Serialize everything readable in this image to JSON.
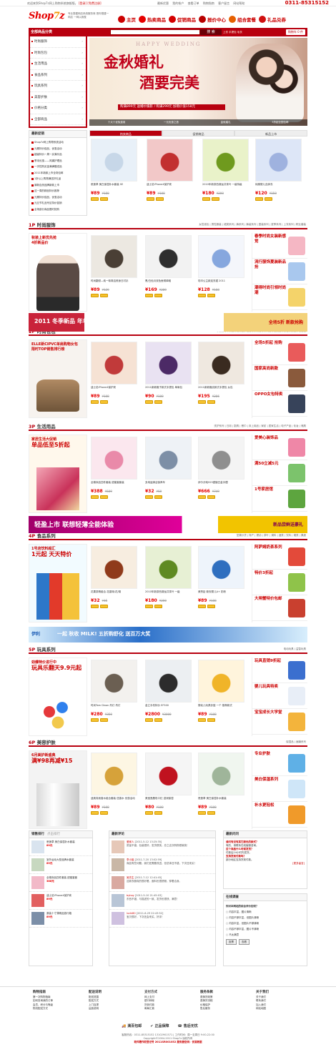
{
  "topbar": {
    "welcome": "欢迎来到Shop7z网上购物系统旗舰版。",
    "login": "[登录]",
    "register": "[免费注册]",
    "links": [
      "最新优惠",
      "我的帐户",
      "查看订单",
      "购物指南",
      "客户留言",
      "网站帮助"
    ],
    "phone": "0311-85315152"
  },
  "header": {
    "logo_a": "Shop",
    "logo_b": "7",
    "logo_c": "z",
    "slogan": "专业搭建网店系统服务商 把你搭建一网店 一网以我做",
    "nav": [
      {
        "label": "主页",
        "color": "#c00"
      },
      {
        "label": "热卖商品",
        "color": "#e60000"
      },
      {
        "label": "促销商品",
        "color": "#d40000"
      },
      {
        "label": "报价中心",
        "color": "#b80000"
      },
      {
        "label": "组合套餐",
        "color": "#e66000"
      },
      {
        "label": "礼品兑券",
        "color": "#d01010"
      }
    ]
  },
  "searchbar": {
    "category_title": "全部商品分类",
    "placeholder": "",
    "search_label": "搜 索",
    "hotwords": "上衣  手提包  毛衣",
    "cart": "购物车 0 件"
  },
  "categories": [
    "时尚服饰",
    "时尚包包",
    "生活用品",
    "食品系列",
    "玩具系列",
    "美容护肤",
    "价格分类",
    "全部商品"
  ],
  "banner": {
    "happy": "HAPPY WEDDING",
    "title1": "金秋婚礼",
    "title2": "酒要完美",
    "promo": "购满899元 送婚纱摄影 / 购满299元 加赠价值158元",
    "tabs": [
      "十大十优免费用",
      "一元优惠之旅",
      "金秋婚礼",
      "3折起全国包邮"
    ]
  },
  "news": {
    "title": "最新促销",
    "items": [
      "Shop7z网上购物系统活动",
      "元素特价促品，优惠活动",
      "超级特价一周一买满乐品",
      "季末优惠——风痛护理品",
      "一次性购买金满满赠送品",
      "2011年新款上市全场包邮",
      "1折以上购物满送好礼品",
      "清新自然品牌新款上市",
      "这一周的精品特价推荐",
      "元素特价促品，优惠活动",
      "元旦节礼品专区特价促销",
      "全场部分商品限时抢购"
    ]
  },
  "promo_tabs": [
    "热卖商品",
    "促销商品",
    "新品上市"
  ],
  "row0": [
    {
      "name": "悉莲草 美白保湿补水套装 SE",
      "price": "¥89",
      "old": "¥180",
      "colors": [
        "#e8f0f8",
        "#c7d7e8"
      ]
    },
    {
      "name": "迪士尼iPhone4保护壳",
      "price": "¥89",
      "old": "¥108",
      "colors": [
        "#f2c8c8",
        "#c23030"
      ]
    },
    {
      "name": "2010年新茶西湖龙井茶叶 一级特级",
      "price": "¥180",
      "old": "¥200",
      "colors": [
        "#e9f2c9",
        "#6f9a1e"
      ]
    },
    {
      "name": "纯棉婴儿连体衣",
      "price": "¥120",
      "old": "¥150",
      "colors": [
        "#dde6f7",
        "#9fb2df"
      ]
    }
  ],
  "sections": [
    {
      "num": "1P",
      "name": "时尚服饰",
      "subs": "女性钱包 | 男性服装 | 裙类系列 | 裤系列 | 裤装系列 | 童装系列 | 夏季系列 | 上衣系列 | 职业套装"
    },
    {
      "num": "2P",
      "name": "时尚包包",
      "subs": "手提包 | 单肩包 | 双肩包 | 钱包 | 斜挎包 | 休闲包 | 公文包 | 男包 | 女包 | 化妆包"
    },
    {
      "num": "3P",
      "name": "生活用品",
      "subs": "洗护系列 | 日用 | 厨具 | 餐巾 | 床上用品 | 家纺 | 居家生活 | 电子产品 | 化妆 | 储具"
    },
    {
      "num": "4P",
      "name": "食品系列",
      "subs": "坚果炒货 | 特产 | 婴幼 | 茶叶 | 调料 | 酒类 | 饮料 | 烟类 | 果蔬"
    },
    {
      "num": "5P",
      "name": "玩具系列",
      "subs": "电动玩具 | 益智玩具"
    },
    {
      "num": "6P",
      "name": "美容护肤",
      "subs": "保湿品 | 面膜系列"
    }
  ],
  "side_ads": [
    {
      "line1": "秋装上新优先抢",
      "line2": "4折新品价"
    },
    {
      "line1": "ELLE新CIPVC单肩购物女包",
      "line2": "限时TOP销售排行榜"
    },
    {
      "line1": "家居生活大促销",
      "line2": "单品低至5折起"
    },
    {
      "line1": "1号店饮料超汇",
      "line2": "1元起 天天特价"
    },
    {
      "line1": "劲爆特价进行中",
      "line2": "玩具乐翻天9.9元起"
    },
    {
      "line1": "6月美护新盛典",
      "line2": "满¥98再减¥15"
    }
  ],
  "row1": [
    {
      "name": "时尚翻领—纯一味简洁修身日衬衫",
      "price": "¥89",
      "old": "¥129",
      "colors": [
        "#ece8e1",
        "#4a3f35"
      ]
    },
    {
      "name": "黑/白色月双色鱼嘴单鞋",
      "price": "¥169",
      "old": "¥289",
      "colors": [
        "#f2f2f2",
        "#2e2e2e"
      ]
    },
    {
      "name": "彩印公主款连衣裙 2011",
      "price": "¥128",
      "old": "¥188",
      "colors": [
        "#f4f6fb",
        "#86a7de"
      ]
    }
  ],
  "right1": [
    "春季时尚女装新感觉",
    "流行服饰夏装新品抢",
    "潮得时尚引领时尚潮"
  ],
  "row2": [
    {
      "name": "迪士尼iPhone4保护壳",
      "price": "¥89",
      "old": "¥108",
      "colors": [
        "#f6e2d4",
        "#c13a3a"
      ]
    },
    {
      "name": "2011新款格子款式手提包 单肩包",
      "price": "¥90",
      "old": "¥100",
      "colors": [
        "#e9e2f2",
        "#4c2a66"
      ]
    },
    {
      "name": "2011新款格纹款式手提包 女包",
      "price": "¥195",
      "old": "¥286",
      "colors": [
        "#efe8e0",
        "#3a2b20"
      ]
    }
  ],
  "right2": [
    "全场5折起 抢购",
    "国家高尚新款",
    "OPPO女包特卖"
  ],
  "row3": [
    {
      "name": "全棉床品四件套装 甜蜜蜜套装",
      "price": "¥388",
      "old": "¥589",
      "colors": [
        "#fbe7ee",
        "#e98aa9"
      ]
    },
    {
      "name": "多用途清洁保养车",
      "price": "¥32",
      "old": "¥50",
      "colors": [
        "#eef2f6",
        "#7d8fa6"
      ]
    },
    {
      "name": "伊尔汐纯925银镀白金手镯",
      "price": "¥666",
      "old": "¥749",
      "colors": [
        "#f4f4f4",
        "#8f8f8f"
      ]
    }
  ],
  "right3": [
    "爱美心装饰品",
    "满50立减5元",
    "1号家居馆"
  ],
  "row4": [
    {
      "name": "花果茶精组合-花香味/花/胡",
      "price": "¥32",
      "old": "¥45",
      "colors": [
        "#f7ede0",
        "#8f3a1b"
      ]
    },
    {
      "name": "2010年新茶西湖龙井茶叶 一级",
      "price": "¥180",
      "old": "¥200",
      "colors": [
        "#e7f0d4",
        "#5f8a22"
      ]
    },
    {
      "name": "美赞臣·新安婴儿A+ 奶粉",
      "price": "¥89",
      "old": "¥108",
      "colors": [
        "#eef4fb",
        "#2f6fbf"
      ]
    }
  ],
  "right4": [
    "阿萨姆奶茶系列",
    "特价3折起",
    "大闸蟹特价包邮"
  ],
  "row5": [
    {
      "name": "时尚Tom Dixon 吊灯 吊灯",
      "price": "¥280",
      "old": "¥350",
      "colors": [
        "#f3f1ee",
        "#6b5f52"
      ]
    },
    {
      "name": "金立手机特价 EF500",
      "price": "¥2800",
      "old": "¥3000",
      "colors": [
        "#eceff2",
        "#2c2c2c"
      ]
    },
    {
      "name": "婴幼儿玩具铃鼓 一个 推荐款式",
      "price": "¥89",
      "old": "¥108",
      "colors": [
        "#fff4dc",
        "#f0b429"
      ]
    }
  ],
  "right5": [
    "玩具直销9折起",
    "婴儿玩具特卖",
    "宝宝成长大学堂"
  ],
  "row6": [
    {
      "name": "迪奥真我香水组合套装 送香水 优惠活动",
      "price": "¥89",
      "old": "¥108",
      "colors": [
        "#fdf6e3",
        "#d6a23a"
      ]
    },
    {
      "name": "美宝莲唇彩口红 滋润保湿",
      "price": "¥80",
      "old": "¥100",
      "colors": [
        "#f5f5f5",
        "#c0121f"
      ]
    },
    {
      "name": "悉莲草 美白保湿补水套装",
      "price": "¥89",
      "old": "¥108",
      "colors": [
        "#f0f6ef",
        "#9fb59a"
      ]
    }
  ],
  "right6": [
    "专业护肤",
    "美白保湿系列",
    "补水更轻松"
  ],
  "hbanners": [
    {
      "text": "2011 冬季新品 年年有",
      "tag": "全场5折 新款抢购"
    },
    {
      "text": "轻盈上市  联想轻薄全能体验",
      "tag": "新品尝鲜送豪礼"
    },
    {
      "text": "一起 秋收 MILK!  五折购舒化 送百万大奖",
      "tag": "伊利"
    }
  ],
  "bottom": {
    "rank_title": "销售排行",
    "rank_tab2": "点击排行",
    "rank": [
      {
        "name": "悉莲草 美白保湿补水套装 ",
        "price": "89元"
      },
      {
        "name": "室外运动大型品牌水套装",
        "price": "89元"
      },
      {
        "name": "全棉床品四件套装 甜蜜蜜套",
        "price": "388元"
      },
      {
        "name": "迪士尼iPhone4保护壳",
        "price": "89元"
      },
      {
        "name": "原装十寸薄精品旅行箱",
        "price": "89元"
      }
    ],
    "comment_title": "最新评论",
    "comments": [
      {
        "user": "爱家人",
        "date": "[2011-5-12 13:25:35]",
        "text": "质量不错，包装很好，发货很快，总之这次购物很愉快！"
      },
      {
        "user": "李小姐",
        "date": "[2011-7-20 13:02:59]",
        "text": "商品有些问题，我们还需要改进，但总体还不错，下次还来买！"
      },
      {
        "user": "吴先生",
        "date": "[2011-7-12 12:41:45]",
        "text": "这款衣服真的很好看，面料也很舒服，穿着合身。"
      },
      {
        "user": "byhay",
        "date": "[2011-5-10 21:45:03]",
        "text": "东西不错，与描述的一致，发货也很快，满意！"
      },
      {
        "user": "lucki80",
        "date": "[2011-6-29 22:43:52]",
        "text": "宝贝很好，下次还会来买，好评！"
      }
    ],
    "qa_title": "最新问问",
    "qa": [
      {
        "q": "请问有没有其它颜色的款式？",
        "a": "有的，请联系在线客服咨询。"
      },
      {
        "q": "这个商品什么时候发货？",
        "a": "付款后24小时内发货。"
      },
      {
        "q": "支持货到付款吗？",
        "a": "部分地区支持货到付款。"
      }
    ],
    "more": "[更多留言]",
    "poll_title": "在线调查",
    "poll_q": "你对本网站的综合评价如何？",
    "poll_options": [
      "内容丰富，图片清晰",
      "内容不够丰富，但图片清晰",
      "内容丰富，但图片不够清晰",
      "内容不够丰富，图片不清晰",
      "不太满意"
    ],
    "vote": "投票",
    "view": "查看"
  },
  "footer": {
    "cols": [
      {
        "h": "购物指南",
        "items": [
          "第一次购物指南",
          "如何查询我的订单",
          "会员、积分与等级",
          "物流配送方式"
        ]
      },
      {
        "h": "配送说明",
        "items": [
          "配送范围",
          "配送方式",
          "上门自提",
          "运费说明"
        ]
      },
      {
        "h": "支付方式",
        "items": [
          "网上支付",
          "银行转帐",
          "货到付款",
          "邮局汇款"
        ]
      },
      {
        "h": "服务条款",
        "items": [
          "退换货政策",
          "退换货流程",
          "价格保护",
          "售后服务"
        ]
      },
      {
        "h": "关于我们",
        "items": [
          "关于我们",
          "联系我们",
          "加入我们",
          "网站地图"
        ]
      }
    ],
    "guarantee": [
      "满百包邮",
      "正品保障",
      "售后无忧"
    ],
    "copyright1": "客服热线：0311-85315152  13102901571 | 工作时间：周一至周日 9:00-22:00",
    "copyright2": "Copyright©2004-2011 Shop7z 版权所有",
    "copyright3": "软件著作权登记号 2011SR001052  服务器空间：优易数据"
  }
}
